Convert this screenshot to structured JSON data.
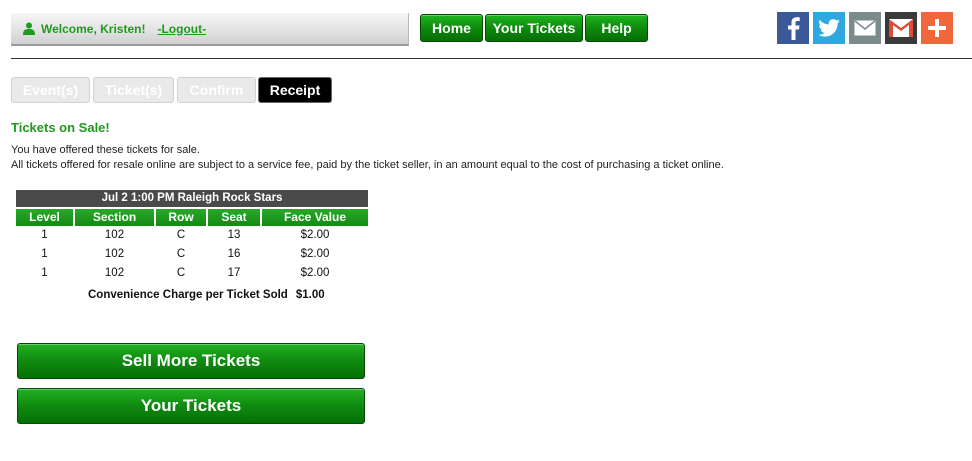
{
  "header": {
    "welcome_text": "Welcome, Kristen!",
    "logout_label": "-Logout-",
    "nav": {
      "home": "Home",
      "your_tickets": "Your Tickets",
      "help": "Help"
    },
    "social": {
      "facebook_icon": "facebook-icon",
      "twitter_icon": "twitter-icon",
      "email_icon": "email-icon",
      "gmail_icon": "gmail-icon",
      "share_icon": "share-plus-icon",
      "colors": {
        "facebook": "#3b5998",
        "twitter": "#2fa8e0",
        "email": "#7b8a8b",
        "gmail": "#dd4b39",
        "share": "#f0673c"
      }
    }
  },
  "steps": {
    "events": "Event(s)",
    "tickets": "Ticket(s)",
    "confirm": "Confirm",
    "receipt": "Receipt"
  },
  "main": {
    "heading": "Tickets on Sale!",
    "message_line1": "You have offered these tickets for sale.",
    "message_line2": "All tickets offered for resale online are subject to a service fee, paid by the ticket seller, in an amount equal to the cost of purchasing a ticket online."
  },
  "ticket_table": {
    "event": "Jul 2 1:00 PM  Raleigh Rock Stars",
    "columns": [
      "Level",
      "Section",
      "Row",
      "Seat",
      "Face Value"
    ],
    "rows": [
      [
        "1",
        "102",
        "C",
        "13",
        "$2.00"
      ],
      [
        "1",
        "102",
        "C",
        "16",
        "$2.00"
      ],
      [
        "1",
        "102",
        "C",
        "17",
        "$2.00"
      ]
    ],
    "charge_label": "Convenience Charge per Ticket Sold",
    "charge_value": "$1.00"
  },
  "actions": {
    "sell_more": "Sell More Tickets",
    "your_tickets": "Your Tickets"
  },
  "colors": {
    "brand_green": "#1f9a1f",
    "button_green": "#0e8a0e",
    "active_step": "#000000"
  }
}
